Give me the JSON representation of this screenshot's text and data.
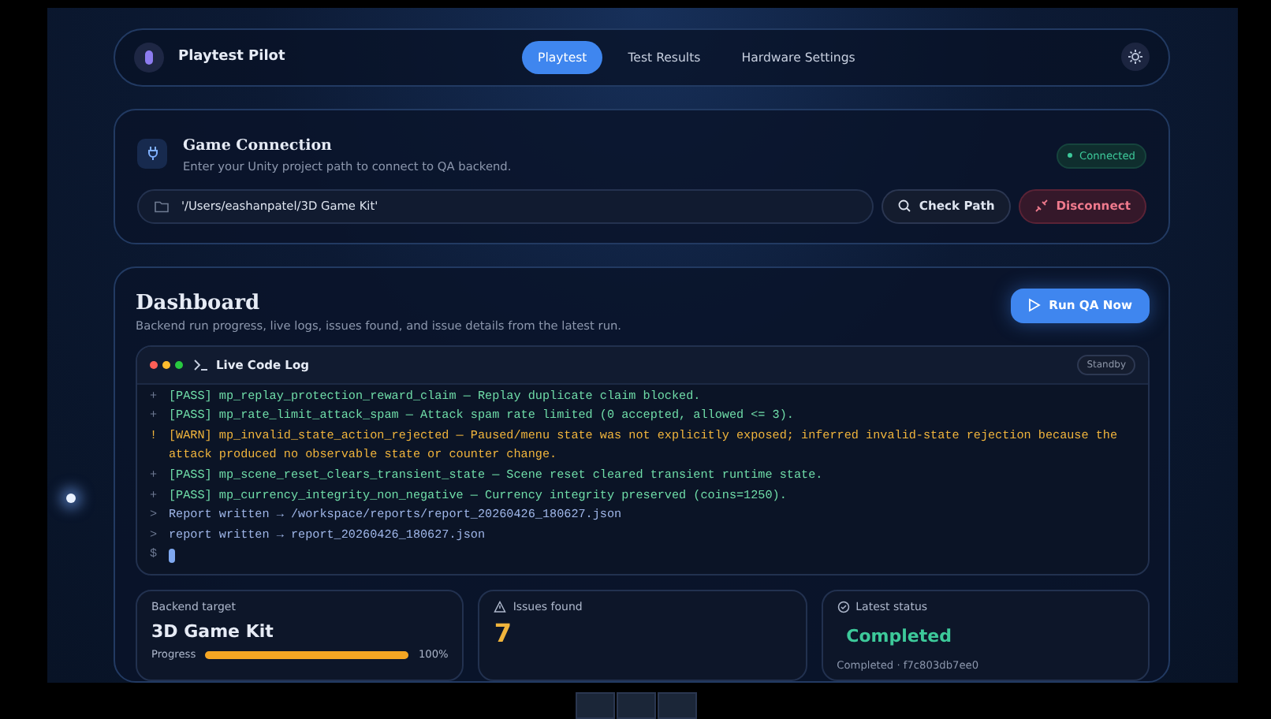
{
  "app": {
    "title": "Playtest Pilot"
  },
  "tabs": [
    {
      "label": "Playtest",
      "selected": true
    },
    {
      "label": "Test Results",
      "selected": false
    },
    {
      "label": "Hardware Settings",
      "selected": false
    }
  ],
  "connection": {
    "title": "Game Connection",
    "subtitle": "Enter your Unity project path to connect to QA backend.",
    "status": "Connected",
    "connected": true,
    "path": "'/Users/eashanpatel/3D Game Kit'",
    "buttons": [
      {
        "label": "Check Path",
        "kind": "neutral"
      },
      {
        "label": "Disconnect",
        "kind": "danger"
      }
    ]
  },
  "dashboard": {
    "title": "Dashboard",
    "subtitle": "Backend run progress, live logs, issues found, and issue details from the latest run.",
    "run_button": "Run QA Now"
  },
  "log": {
    "title": "Live Code Log",
    "badge": "Standby",
    "lines": [
      {
        "kind": "pass",
        "prefix": "+",
        "text": "[PASS] mp_replay_protection_reward_claim — Replay duplicate claim blocked."
      },
      {
        "kind": "pass",
        "prefix": "+",
        "text": "[PASS] mp_rate_limit_attack_spam — Attack spam rate limited (0 accepted, allowed <= 3)."
      },
      {
        "kind": "warn",
        "prefix": "!",
        "text": "[WARN] mp_invalid_state_action_rejected — Paused/menu state was not explicitly exposed; inferred invalid-state rejection because the attack produced no observable state or counter change."
      },
      {
        "kind": "pass",
        "prefix": "+",
        "text": "[PASS] mp_scene_reset_clears_transient_state — Scene reset cleared transient runtime state."
      },
      {
        "kind": "pass",
        "prefix": "+",
        "text": "[PASS] mp_currency_integrity_non_negative — Currency integrity preserved (coins=1250)."
      },
      {
        "kind": "info",
        "prefix": ">",
        "text": "Report written → /workspace/reports/report_20260426_180627.json"
      },
      {
        "kind": "info",
        "prefix": ">",
        "text": "report written → report_20260426_180627.json"
      }
    ],
    "prompt": "$"
  },
  "stats": [
    {
      "kind": "target",
      "label": "Backend target",
      "value": "3D Game Kit",
      "progress_label": "Progress",
      "level": 1.0,
      "reading": "100%"
    },
    {
      "kind": "issues",
      "label": "Issues found",
      "value": "7"
    },
    {
      "kind": "status",
      "label": "Latest status",
      "value": "Completed",
      "detail": "Completed · f7c803db7ee0"
    }
  ]
}
